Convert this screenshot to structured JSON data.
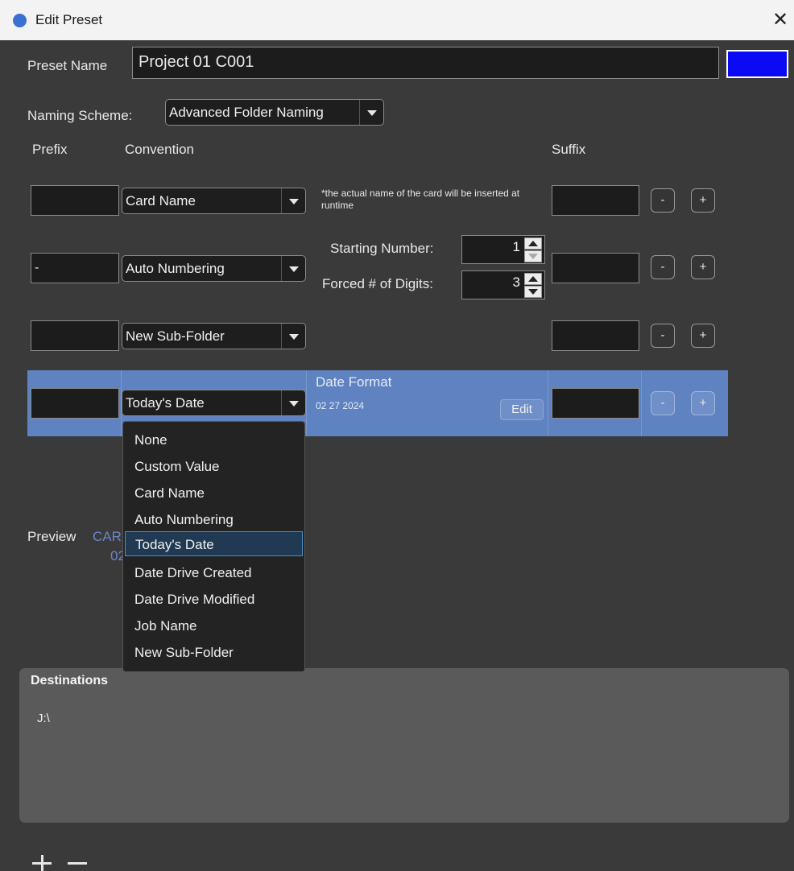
{
  "window": {
    "title": "Edit Preset",
    "close_glyph": "✕"
  },
  "preset": {
    "name_label": "Preset Name",
    "name_value": "Project 01 C001",
    "color": "#0a0af5"
  },
  "naming": {
    "label": "Naming Scheme:",
    "value": "Advanced Folder Naming"
  },
  "columns": {
    "prefix": "Prefix",
    "convention": "Convention",
    "suffix": "Suffix"
  },
  "rows": [
    {
      "prefix": "",
      "convention": "Card Name",
      "note": "*the actual name of the card will be inserted at runtime",
      "suffix": ""
    },
    {
      "prefix": "-",
      "convention": "Auto Numbering",
      "starting_label": "Starting Number:",
      "starting_value": "1",
      "digits_label": "Forced # of Digits:",
      "digits_value": "3",
      "suffix": ""
    },
    {
      "prefix": "",
      "convention": "New Sub-Folder",
      "suffix": ""
    },
    {
      "prefix": "",
      "convention": "Today's Date",
      "date_format_label": "Date Format",
      "date_format_value": "02 27 2024",
      "edit_label": "Edit",
      "suffix": ""
    }
  ],
  "row_buttons": {
    "minus": "-",
    "plus": "+"
  },
  "preview": {
    "label": "Preview",
    "value_line1": "CAR",
    "value_line2": "02"
  },
  "dropdown": {
    "options": [
      "None",
      "Custom Value",
      "Card Name",
      "Auto Numbering",
      "Today's Date",
      "Date Drive Created",
      "Date Drive Modified",
      "Job Name",
      "New Sub-Folder"
    ],
    "selected": "Today's Date"
  },
  "destinations": {
    "header": "Destinations",
    "items": [
      "J:\\"
    ]
  },
  "colors": {
    "accent_row": "#5f82c0",
    "preview_text": "#6b86c9",
    "selected_item_border": "#4a8fc6"
  },
  "icons": {
    "app": "app-circle-icon",
    "close": "close-icon",
    "dropdown": "chevron-down-icon",
    "add": "plus-icon",
    "remove": "minus-icon"
  }
}
